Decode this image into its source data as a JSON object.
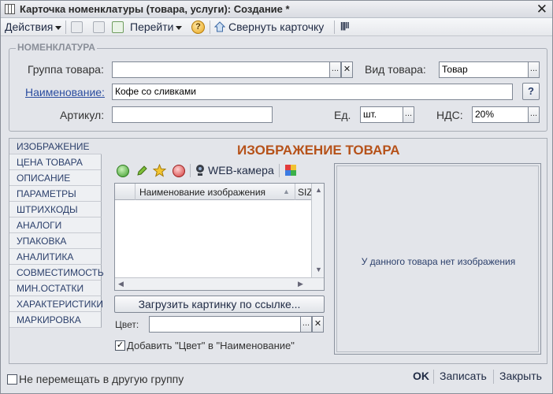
{
  "window": {
    "title": "Карточка номенклатуры (товара, услуги): Создание *"
  },
  "toolbar": {
    "actions_label": "Действия",
    "goto_label": "Перейти",
    "help_label": "?",
    "collapse_label": "Свернуть карточку"
  },
  "nomenclature": {
    "group_title": "НОМЕНКЛАТУРА",
    "group_label": "Группа товара:",
    "group_value": "",
    "type_label": "Вид товара:",
    "type_value": "Товар",
    "name_label": "Наименование:",
    "name_value": "Кофе со сливками",
    "help_btn": "?",
    "article_label": "Артикул:",
    "article_value": "",
    "unit_label": "Ед.",
    "unit_value": "шт.",
    "vat_label": "НДС:",
    "vat_value": "20%"
  },
  "tabs": [
    {
      "label": "ИЗОБРАЖЕНИЕ"
    },
    {
      "label": "ЦЕНА ТОВАРА"
    },
    {
      "label": "ОПИСАНИЕ"
    },
    {
      "label": "ПАРАМЕТРЫ"
    },
    {
      "label": "ШТРИХКОДЫ"
    },
    {
      "label": "АНАЛОГИ"
    },
    {
      "label": "УПАКОВКА"
    },
    {
      "label": "АНАЛИТИКА"
    },
    {
      "label": "СОВМЕСТИМОСТЬ"
    },
    {
      "label": "МИН.ОСТАТКИ"
    },
    {
      "label": "ХАРАКТЕРИСТИКИ"
    },
    {
      "label": "МАРКИРОВКА"
    }
  ],
  "image_tab": {
    "title": "ИЗОБРАЖЕНИЕ ТОВАРА",
    "webcam_label": "WEB-камера",
    "grid_col_name": "Наименование изображения",
    "grid_col_size": "SIZ",
    "load_btn": "Загрузить картинку по ссылке...",
    "color_label": "Цвет:",
    "color_value": "",
    "add_color_label": "Добавить \"Цвет\" в \"Наименование\"",
    "add_color_checked": true,
    "no_image_text": "У данного товара нет изображения"
  },
  "footer": {
    "no_move_label": "Не перемещать в другую группу",
    "ok_label": "OK",
    "save_label": "Записать",
    "close_label": "Закрыть"
  }
}
